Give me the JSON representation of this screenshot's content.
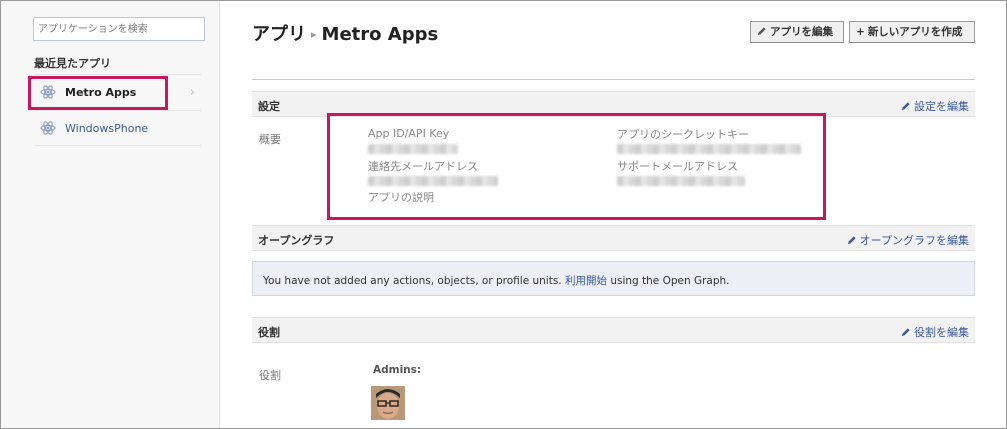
{
  "sidebar": {
    "search_placeholder": "アプリケーションを検索",
    "recent_title": "最近見たアプリ",
    "items": [
      {
        "label": "Metro Apps"
      },
      {
        "label": "WindowsPhone"
      }
    ]
  },
  "header": {
    "breadcrumb_root": "アプリ",
    "breadcrumb_sep": "▸",
    "app_name": "Metro Apps",
    "edit_button": "アプリを編集",
    "new_button": "新しいアプリを作成"
  },
  "settings": {
    "title": "設定",
    "edit_link": "設定を編集",
    "overview_label": "概要",
    "fields": {
      "app_id": "App ID/API Key",
      "secret": "アプリのシークレットキー",
      "contact_email": "連絡先メールアドレス",
      "support_email": "サポートメールアドレス",
      "description": "アプリの説明"
    }
  },
  "open_graph": {
    "title": "オープングラフ",
    "edit_link": "オープングラフを編集",
    "message_before": "You have not added any actions, objects, or profile units. ",
    "message_link": "利用開始",
    "message_after": " using the Open Graph."
  },
  "roles": {
    "title": "役割",
    "edit_link": "役割を編集",
    "row_label": "役割",
    "admins_label": "Admins:"
  },
  "colors": {
    "highlight": "#c8175d",
    "link": "#3b5998"
  },
  "icons": {
    "app": "atom-icon",
    "edit": "pencil-icon",
    "add": "plus-icon",
    "chevron": "chevron-right-icon"
  }
}
